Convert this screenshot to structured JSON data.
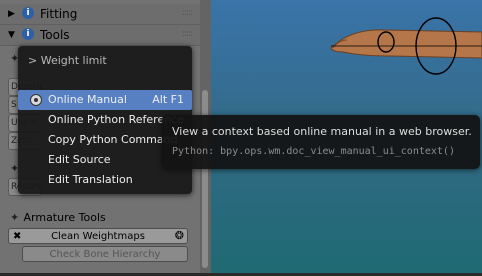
{
  "panel": {
    "sections": [
      {
        "label": "Fitting"
      },
      {
        "label": "Tools"
      }
    ],
    "partial_rows": [
      "Descrip",
      "S",
      "Use d",
      "Zero W",
      "Reparen"
    ],
    "armature_tools": {
      "label": "Armature Tools",
      "clean_weightmaps": "Clean Weightmaps",
      "check_bone_hierarchy": "Check Bone Hierarchy"
    }
  },
  "menu": {
    "title": "> Weight limit",
    "items": [
      {
        "label": "Online Manual",
        "shortcut": "Alt F1",
        "highlighted": true
      },
      {
        "label": "Online Python Reference",
        "shortcut": ""
      },
      {
        "label": "Copy Python Command",
        "shortcut": ""
      },
      {
        "label": "Edit Source",
        "shortcut": ""
      },
      {
        "label": "Edit Translation",
        "shortcut": ""
      }
    ]
  },
  "tooltip": {
    "description": "View a context based online manual in a web browser.",
    "python": "Python: bpy.ops.wm.doc_view_manual_ui_context()"
  },
  "colors": {
    "highlight": "#5680c2",
    "menu_bg": "#181818",
    "viewport_top": "#3a74a9",
    "viewport_bottom": "#1f6a73",
    "model_skin": "#b5764a"
  }
}
